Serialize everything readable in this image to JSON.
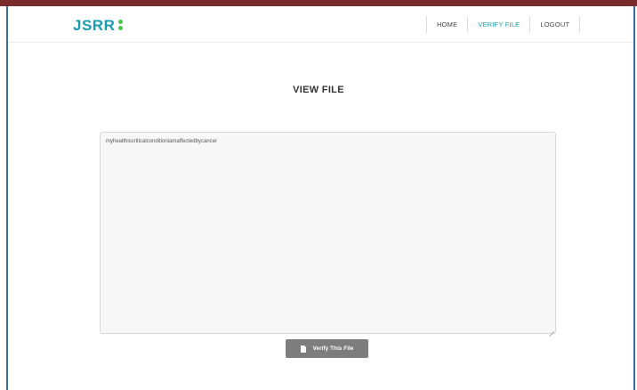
{
  "brand": {
    "name": "JSRR",
    "accent": "#1b9bb0",
    "dot_color": "#4cc44a"
  },
  "nav": {
    "items": [
      {
        "label": "HOME",
        "active": false
      },
      {
        "label": "VERIFY FILE",
        "active": true
      },
      {
        "label": "LOGOUT",
        "active": false
      }
    ]
  },
  "main": {
    "title": "VIEW FILE",
    "file_content": "myhealthiscriticalconditioniamaffectedbycancer",
    "verify_button_label": "Verify This File",
    "verify_button_icon": "file-icon"
  },
  "colors": {
    "top_bar": "#7a2b2b",
    "frame": "#3d6aa6",
    "button": "#7d7d7d"
  }
}
